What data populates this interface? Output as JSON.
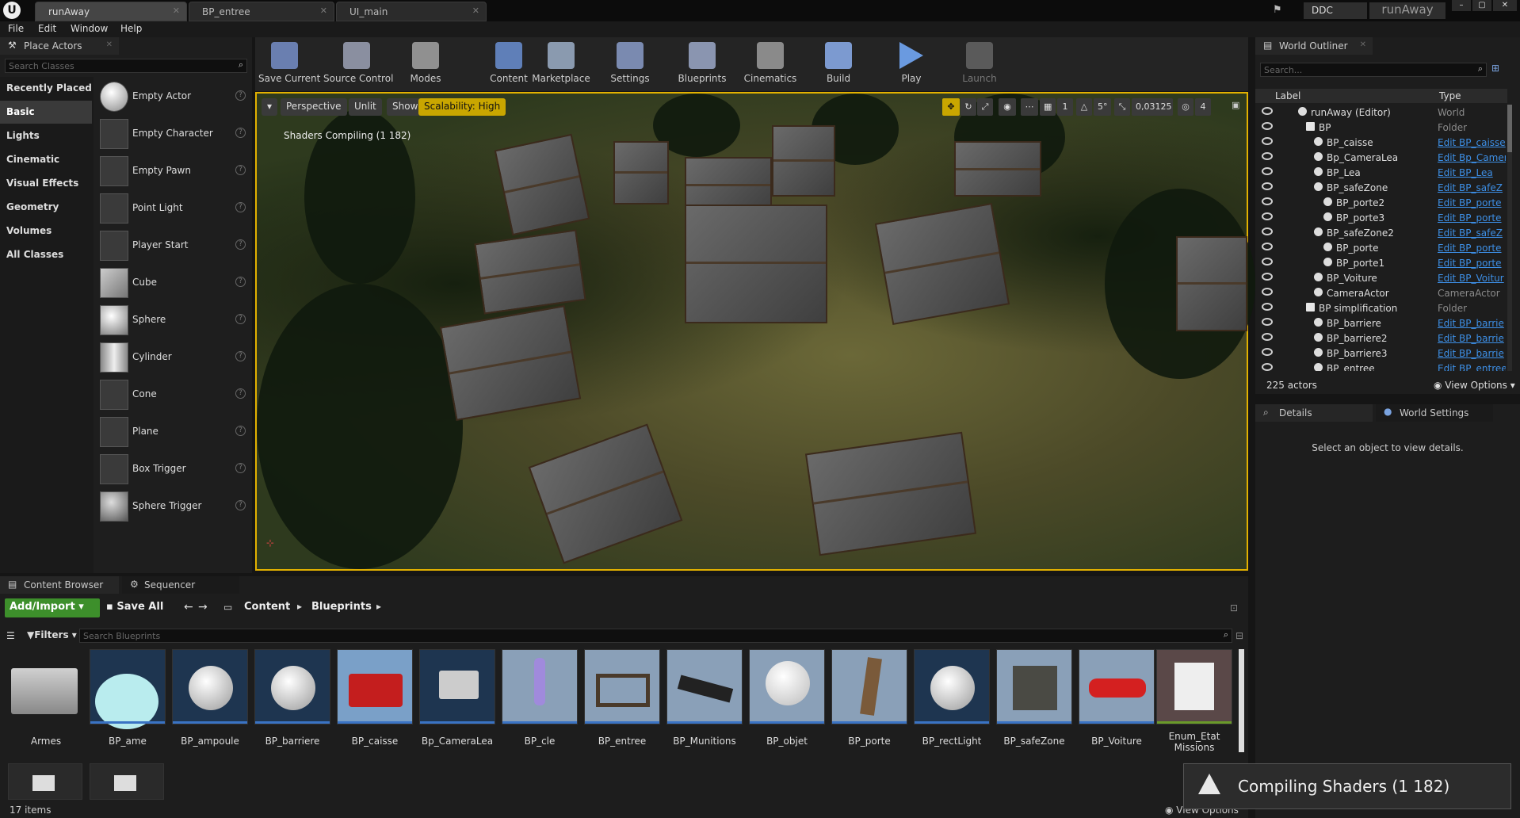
{
  "titlebar": {
    "tabs": [
      "runAway",
      "BP_entree",
      "UI_main"
    ],
    "ddc": "DDC",
    "project": "runAway"
  },
  "menu": [
    "File",
    "Edit",
    "Window",
    "Help"
  ],
  "place_actors": {
    "title": "Place Actors",
    "search_placeholder": "Search Classes",
    "categories": [
      "Recently Placed",
      "Basic",
      "Lights",
      "Cinematic",
      "Visual Effects",
      "Geometry",
      "Volumes",
      "All Classes"
    ],
    "actors": [
      "Empty Actor",
      "Empty Character",
      "Empty Pawn",
      "Point Light",
      "Player Start",
      "Cube",
      "Sphere",
      "Cylinder",
      "Cone",
      "Plane",
      "Box Trigger",
      "Sphere Trigger"
    ]
  },
  "toolbar": [
    "Save Current",
    "Source Control",
    "Modes",
    "Content",
    "Marketplace",
    "Settings",
    "Blueprints",
    "Cinematics",
    "Build",
    "Play",
    "Launch"
  ],
  "viewport": {
    "perspective": "Perspective",
    "unlit": "Unlit",
    "show": "Show",
    "scalability": "Scalability: High",
    "status": "Shaders Compiling (1   182)",
    "grid_value": "1",
    "angle_value": "5°",
    "scale_value": "0,03125",
    "camera_speed": "4"
  },
  "outliner": {
    "title": "World Outliner",
    "search_placeholder": "Search...",
    "col_label": "Label",
    "col_type": "Type",
    "rows": [
      {
        "name": "runAway (Editor)",
        "type": "World"
      },
      {
        "name": "BP",
        "type": "Folder"
      },
      {
        "name": "BP_caisse",
        "type": "Edit BP_caisse"
      },
      {
        "name": "Bp_CameraLea",
        "type": "Edit Bp_Camer"
      },
      {
        "name": "BP_Lea",
        "type": "Edit BP_Lea"
      },
      {
        "name": "BP_safeZone",
        "type": "Edit BP_safeZ"
      },
      {
        "name": "BP_porte2",
        "type": "Edit BP_porte"
      },
      {
        "name": "BP_porte3",
        "type": "Edit BP_porte"
      },
      {
        "name": "BP_safeZone2",
        "type": "Edit BP_safeZ"
      },
      {
        "name": "BP_porte",
        "type": "Edit BP_porte"
      },
      {
        "name": "BP_porte1",
        "type": "Edit BP_porte"
      },
      {
        "name": "BP_Voiture",
        "type": "Edit BP_Voitur"
      },
      {
        "name": "CameraActor",
        "type": "CameraActor"
      },
      {
        "name": "BP simplification",
        "type": "Folder"
      },
      {
        "name": "BP_barriere",
        "type": "Edit BP_barrie"
      },
      {
        "name": "BP_barriere2",
        "type": "Edit BP_barrie"
      },
      {
        "name": "BP_barriere3",
        "type": "Edit BP_barrie"
      },
      {
        "name": "BP_entree",
        "type": "Edit BP_entree"
      }
    ],
    "actor_count": "225 actors",
    "view_options": "View Options"
  },
  "details": {
    "tab_details": "Details",
    "tab_world_settings": "World Settings",
    "empty_message": "Select an object to view details."
  },
  "content_browser": {
    "tab": "Content Browser",
    "tab_sequencer": "Sequencer",
    "add_import": "Add/Import",
    "save_all": "Save All",
    "path": [
      "Content",
      "Blueprints"
    ],
    "filters": "Filters",
    "search_placeholder": "Search Blueprints",
    "assets": [
      "Armes",
      "BP_ame",
      "BP_ampoule",
      "BP_barriere",
      "BP_caisse",
      "Bp_CameraLea",
      "BP_cle",
      "BP_entree",
      "BP_Munitions",
      "BP_objet",
      "BP_porte",
      "BP_rectLight",
      "BP_safeZone",
      "BP_Voiture",
      "Enum_Etat Missions"
    ],
    "item_count": "17 items",
    "view_options": "View Options"
  },
  "toast": {
    "message": "Compiling Shaders (1 182)"
  }
}
